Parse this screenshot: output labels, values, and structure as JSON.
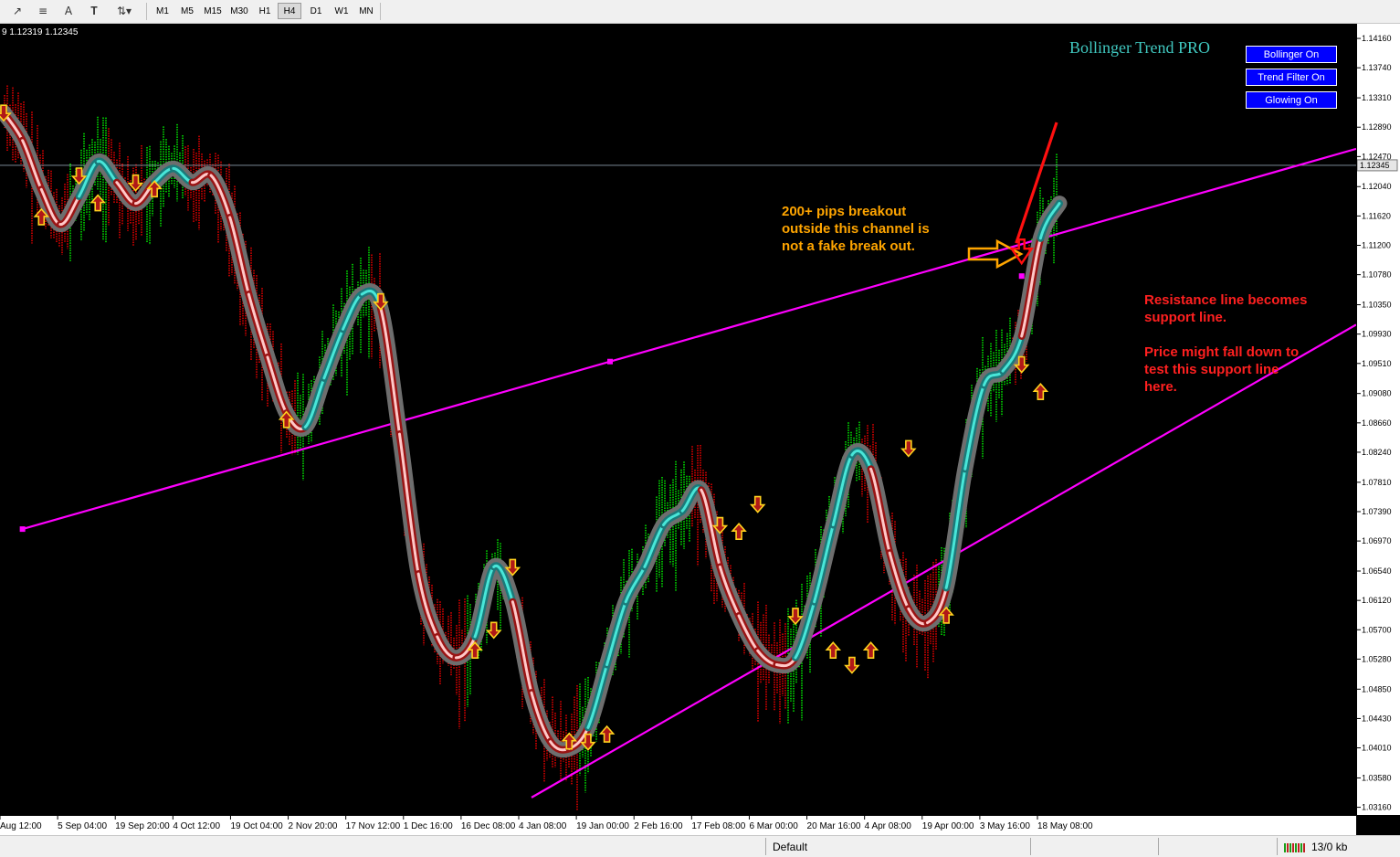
{
  "toolbar": {
    "icons": [
      "indicators-icon",
      "objects-icon",
      "text-icon",
      "text-label-icon",
      "arrows-icon"
    ],
    "timeframes": [
      "M1",
      "M5",
      "M15",
      "M30",
      "H1",
      "H4",
      "D1",
      "W1",
      "MN"
    ],
    "active_timeframe": "H4"
  },
  "chart_header": {
    "quote": "9 1.12319 1.12345"
  },
  "indicator": {
    "name": "Bollinger Trend PRO",
    "buttons": [
      "Bollinger On",
      "Trend Filter On",
      "Glowing On"
    ]
  },
  "annotations": {
    "breakout_note": [
      "200+ pips breakout",
      "outside this channel is",
      "not a fake break out."
    ],
    "support_note": [
      "Resistance line becomes",
      "support line.",
      "",
      "Price might fall down to",
      "test this support line",
      "here."
    ]
  },
  "current_price": "1.12345",
  "colors": {
    "background": "#000000",
    "channel": "#ff00ff",
    "bull": "#00ff00",
    "bear": "#ff0000",
    "note_orange": "#ffa500",
    "note_red": "#ff2020"
  },
  "chart_data": {
    "type": "line",
    "title": "",
    "ylim": [
      1.0305,
      1.1437
    ],
    "price_ticks": [
      "1.14160",
      "1.13740",
      "1.13310",
      "1.12890",
      "1.12470",
      "1.12040",
      "1.11620",
      "1.11200",
      "1.10780",
      "1.10350",
      "1.09930",
      "1.09510",
      "1.09080",
      "1.08660",
      "1.08240",
      "1.07810",
      "1.07390",
      "1.06970",
      "1.06540",
      "1.06120",
      "1.05700",
      "1.05280",
      "1.04850",
      "1.04430",
      "1.04010",
      "1.03580",
      "1.03160"
    ],
    "time_ticks": [
      "Aug 12:00",
      "5 Sep 04:00",
      "19 Sep 20:00",
      "4 Oct 12:00",
      "19 Oct 04:00",
      "2 Nov 20:00",
      "17 Nov 12:00",
      "1 Dec 16:00",
      "16 Dec 08:00",
      "4 Jan 08:00",
      "19 Jan 00:00",
      "2 Feb 16:00",
      "17 Feb 08:00",
      "6 Mar 00:00",
      "20 Mar 16:00",
      "4 Apr 08:00",
      "19 Apr 00:00",
      "3 May 16:00",
      "18 May 08:00"
    ],
    "price": [
      1.131,
      1.127,
      1.12,
      1.115,
      1.119,
      1.124,
      1.121,
      1.118,
      1.121,
      1.123,
      1.121,
      1.122,
      1.116,
      1.105,
      1.096,
      1.088,
      1.086,
      1.093,
      1.1,
      1.105,
      1.103,
      1.085,
      1.065,
      1.056,
      1.053,
      1.056,
      1.066,
      1.061,
      1.048,
      1.041,
      1.04,
      1.043,
      1.052,
      1.061,
      1.066,
      1.072,
      1.074,
      1.077,
      1.066,
      1.059,
      1.054,
      1.052,
      1.053,
      1.061,
      1.072,
      1.082,
      1.08,
      1.068,
      1.06,
      1.058,
      1.063,
      1.08,
      1.092,
      1.094,
      1.099,
      1.113,
      1.118
    ],
    "trend_direction": [
      "down",
      "down",
      "down",
      "down",
      "up",
      "up",
      "down",
      "down",
      "up",
      "up",
      "down",
      "down",
      "down",
      "down",
      "down",
      "down",
      "up",
      "up",
      "up",
      "up",
      "down",
      "down",
      "down",
      "down",
      "down",
      "up",
      "up",
      "down",
      "down",
      "down",
      "down",
      "up",
      "up",
      "up",
      "up",
      "up",
      "up",
      "down",
      "down",
      "down",
      "down",
      "down",
      "up",
      "up",
      "up",
      "up",
      "down",
      "down",
      "down",
      "down",
      "up",
      "up",
      "up",
      "up",
      "down",
      "up",
      "up"
    ],
    "signals": [
      {
        "x": 0,
        "price": 1.131,
        "dir": "down"
      },
      {
        "x": 2,
        "price": 1.116,
        "dir": "up"
      },
      {
        "x": 4,
        "price": 1.122,
        "dir": "down"
      },
      {
        "x": 5,
        "price": 1.118,
        "dir": "up"
      },
      {
        "x": 7,
        "price": 1.121,
        "dir": "down"
      },
      {
        "x": 8,
        "price": 1.12,
        "dir": "up"
      },
      {
        "x": 15,
        "price": 1.087,
        "dir": "up"
      },
      {
        "x": 20,
        "price": 1.104,
        "dir": "down"
      },
      {
        "x": 25,
        "price": 1.054,
        "dir": "up"
      },
      {
        "x": 26,
        "price": 1.057,
        "dir": "down"
      },
      {
        "x": 27,
        "price": 1.066,
        "dir": "down"
      },
      {
        "x": 30,
        "price": 1.041,
        "dir": "up"
      },
      {
        "x": 31,
        "price": 1.041,
        "dir": "down"
      },
      {
        "x": 32,
        "price": 1.042,
        "dir": "up"
      },
      {
        "x": 38,
        "price": 1.072,
        "dir": "down"
      },
      {
        "x": 39,
        "price": 1.071,
        "dir": "up"
      },
      {
        "x": 40,
        "price": 1.075,
        "dir": "down"
      },
      {
        "x": 42,
        "price": 1.059,
        "dir": "down"
      },
      {
        "x": 44,
        "price": 1.054,
        "dir": "up"
      },
      {
        "x": 45,
        "price": 1.052,
        "dir": "down"
      },
      {
        "x": 46,
        "price": 1.054,
        "dir": "up"
      },
      {
        "x": 48,
        "price": 1.083,
        "dir": "down"
      },
      {
        "x": 50,
        "price": 1.059,
        "dir": "up"
      },
      {
        "x": 54,
        "price": 1.095,
        "dir": "down"
      },
      {
        "x": 55,
        "price": 1.091,
        "dir": "up"
      }
    ],
    "channel_upper": {
      "start": [
        1,
        1.0714
      ],
      "end": [
        56,
        1.1137
      ]
    },
    "channel_lower": {
      "start": [
        28,
        1.033
      ],
      "end": [
        56,
        1.0763
      ]
    },
    "arrow_target": {
      "x": 54,
      "price": 1.1076
    },
    "xlabel": "",
    "ylabel": "",
    "grid": false
  },
  "status_bar": {
    "profile": "Default",
    "traffic": "13/0 kb"
  }
}
